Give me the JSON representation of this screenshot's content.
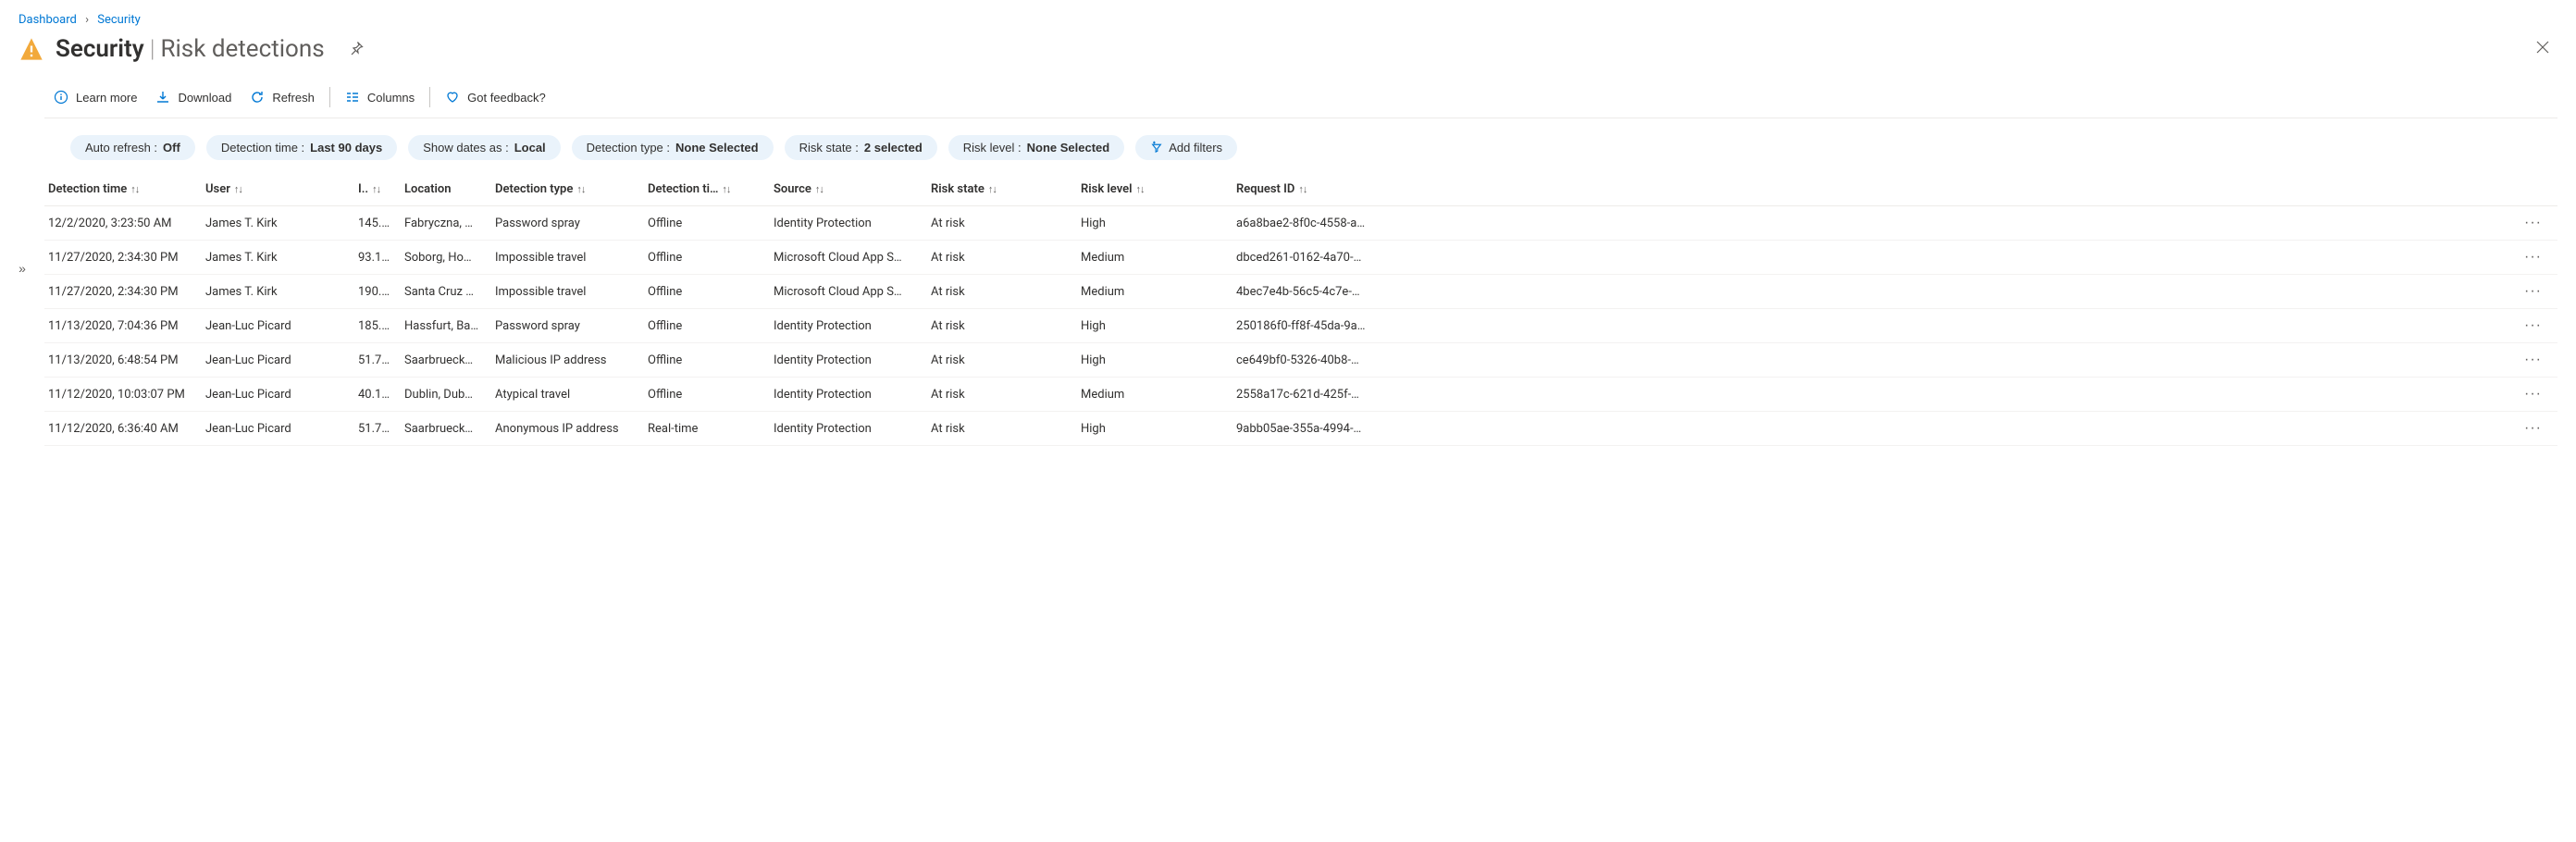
{
  "breadcrumb": {
    "items": [
      {
        "label": "Dashboard"
      },
      {
        "label": "Security"
      }
    ]
  },
  "header": {
    "title": "Security",
    "subtitle": "Risk detections"
  },
  "commands": {
    "learn_more": "Learn more",
    "download": "Download",
    "refresh": "Refresh",
    "columns": "Columns",
    "feedback": "Got feedback?"
  },
  "filters": {
    "auto_refresh": {
      "label": "Auto refresh : ",
      "value": "Off"
    },
    "detection_time": {
      "label": "Detection time : ",
      "value": "Last 90 days"
    },
    "show_dates": {
      "label": "Show dates as : ",
      "value": "Local"
    },
    "detection_type": {
      "label": "Detection type : ",
      "value": "None Selected"
    },
    "risk_state": {
      "label": "Risk state : ",
      "value": "2 selected"
    },
    "risk_level": {
      "label": "Risk level : ",
      "value": "None Selected"
    },
    "add": "Add filters"
  },
  "table": {
    "columns": {
      "detection_time": "Detection time",
      "user": "User",
      "ip": "I..",
      "location": "Location",
      "detection_type": "Detection type",
      "detection_timing": "Detection ti…",
      "source": "Source",
      "risk_state": "Risk state",
      "risk_level": "Risk level",
      "request_id": "Request ID"
    },
    "rows": [
      {
        "detection_time": "12/2/2020, 3:23:50 AM",
        "user": "James T. Kirk",
        "ip": "145.…",
        "location": "Fabryczna, …",
        "detection_type": "Password spray",
        "detection_timing": "Offline",
        "source": "Identity Protection",
        "risk_state": "At risk",
        "risk_level": "High",
        "request_id": "a6a8bae2-8f0c-4558-a…"
      },
      {
        "detection_time": "11/27/2020, 2:34:30 PM",
        "user": "James T. Kirk",
        "ip": "93.1…",
        "location": "Soborg, Ho…",
        "detection_type": "Impossible travel",
        "detection_timing": "Offline",
        "source": "Microsoft Cloud App S…",
        "risk_state": "At risk",
        "risk_level": "Medium",
        "request_id": "dbced261-0162-4a70-…"
      },
      {
        "detection_time": "11/27/2020, 2:34:30 PM",
        "user": "James T. Kirk",
        "ip": "190.…",
        "location": "Santa Cruz …",
        "detection_type": "Impossible travel",
        "detection_timing": "Offline",
        "source": "Microsoft Cloud App S…",
        "risk_state": "At risk",
        "risk_level": "Medium",
        "request_id": "4bec7e4b-56c5-4c7e-…"
      },
      {
        "detection_time": "11/13/2020, 7:04:36 PM",
        "user": "Jean-Luc Picard",
        "ip": "185.…",
        "location": "Hassfurt, Ba…",
        "detection_type": "Password spray",
        "detection_timing": "Offline",
        "source": "Identity Protection",
        "risk_state": "At risk",
        "risk_level": "High",
        "request_id": "250186f0-ff8f-45da-9a…"
      },
      {
        "detection_time": "11/13/2020, 6:48:54 PM",
        "user": "Jean-Luc Picard",
        "ip": "51.7…",
        "location": "Saarbrueck…",
        "detection_type": "Malicious IP address",
        "detection_timing": "Offline",
        "source": "Identity Protection",
        "risk_state": "At risk",
        "risk_level": "High",
        "request_id": "ce649bf0-5326-40b8-…"
      },
      {
        "detection_time": "11/12/2020, 10:03:07 PM",
        "user": "Jean-Luc Picard",
        "ip": "40.1…",
        "location": "Dublin, Dub…",
        "detection_type": "Atypical travel",
        "detection_timing": "Offline",
        "source": "Identity Protection",
        "risk_state": "At risk",
        "risk_level": "Medium",
        "request_id": "2558a17c-621d-425f-…"
      },
      {
        "detection_time": "11/12/2020, 6:36:40 AM",
        "user": "Jean-Luc Picard",
        "ip": "51.7…",
        "location": "Saarbrueck…",
        "detection_type": "Anonymous IP address",
        "detection_timing": "Real-time",
        "source": "Identity Protection",
        "risk_state": "At risk",
        "risk_level": "High",
        "request_id": "9abb05ae-355a-4994-…"
      }
    ]
  }
}
